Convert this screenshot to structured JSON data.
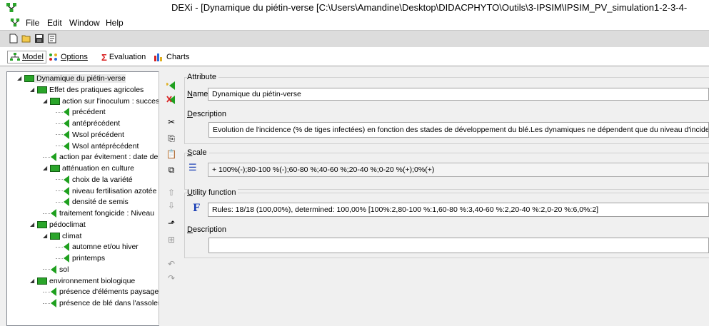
{
  "window": {
    "title": "DEXi - [Dynamique du piétin-verse [C:\\Users\\Amandine\\Desktop\\DIDACPHYTO\\Outils\\3-IPSIM\\IPSIM_PV_simulation1-2-3-4-"
  },
  "menu": [
    "File",
    "Edit",
    "Window",
    "Help"
  ],
  "toolbar": [
    "new-file-icon",
    "open-folder-icon",
    "save-icon",
    "properties-icon"
  ],
  "tabs": [
    {
      "label": "Model",
      "icon": "model-tree-icon",
      "active": true
    },
    {
      "label": "Options",
      "icon": "options-dots-icon",
      "active": false
    },
    {
      "label": "Evaluation",
      "icon": "sigma-icon",
      "active": false
    },
    {
      "label": "Charts",
      "icon": "chart-icon",
      "active": false
    }
  ],
  "tree": [
    {
      "label": "Dynamique du piétin-verse",
      "level": 0,
      "kind": "aggregate",
      "expanded": true
    },
    {
      "label": "Effet des pratiques agricoles",
      "level": 1,
      "kind": "aggregate",
      "expanded": true
    },
    {
      "label": "action sur l'inoculum : successi",
      "level": 2,
      "kind": "aggregate",
      "expanded": true
    },
    {
      "label": "précédent",
      "level": 3,
      "kind": "basic"
    },
    {
      "label": "antéprécédent",
      "level": 3,
      "kind": "basic"
    },
    {
      "label": "Wsol précédent",
      "level": 3,
      "kind": "basic"
    },
    {
      "label": "Wsol antéprécédent",
      "level": 3,
      "kind": "basic"
    },
    {
      "label": "action par évitement : date de",
      "level": 2,
      "kind": "basic"
    },
    {
      "label": "atténuation en culture",
      "level": 2,
      "kind": "aggregate",
      "expanded": true
    },
    {
      "label": "choix de la variété",
      "level": 3,
      "kind": "basic"
    },
    {
      "label": "niveau fertilisation azotée",
      "level": 3,
      "kind": "basic"
    },
    {
      "label": "densité de semis",
      "level": 3,
      "kind": "basic"
    },
    {
      "label": "traitement fongicide : Niveau",
      "level": 2,
      "kind": "basic"
    },
    {
      "label": "pédoclimat",
      "level": 1,
      "kind": "aggregate",
      "expanded": true
    },
    {
      "label": "climat",
      "level": 2,
      "kind": "aggregate",
      "expanded": true
    },
    {
      "label": "automne et/ou hiver",
      "level": 3,
      "kind": "basic"
    },
    {
      "label": "printemps",
      "level": 3,
      "kind": "basic"
    },
    {
      "label": "sol",
      "level": 2,
      "kind": "basic"
    },
    {
      "label": "environnement biologique",
      "level": 1,
      "kind": "aggregate",
      "expanded": true
    },
    {
      "label": "présence d'éléments paysager",
      "level": 2,
      "kind": "basic"
    },
    {
      "label": "présence de blé dans l'assolen",
      "level": 2,
      "kind": "basic"
    }
  ],
  "sidebar_buttons": [
    "add-attribute-icon",
    "delete-attribute-icon",
    "cut-icon",
    "copy-icon",
    "paste-icon",
    "duplicate-icon",
    "move-up-icon",
    "move-down-icon",
    "promote-icon",
    "demote-icon",
    "undo-icon",
    "redo-icon"
  ],
  "attribute": {
    "section_label": "Attribute",
    "name_label": "Name",
    "name_value": "Dynamique du piétin-verse",
    "description_label": "Description",
    "description_value": "Evolution de l'incidence (% de tiges infectées) en fonction des stades de développement du blé.Les dynamiques ne dépendent que du niveau d'incidence finale"
  },
  "scale": {
    "section_label": "Scale",
    "value": "+ 100%(-);80-100 %(-);60-80 %;40-60 %;20-40 %;0-20 %(+);0%(+)"
  },
  "utility": {
    "section_label": "Utility function",
    "value": "Rules: 18/18 (100,00%), determined: 100,00% [100%:2,80-100 %:1,60-80 %:3,40-60 %:2,20-40 %:2,0-20 %:6,0%:2]",
    "description_label": "Description",
    "description_value": ""
  },
  "colors": {
    "aggregate_green": "#2aa52a",
    "basic_green": "#1fa01f",
    "function_blue": "#1a3fb5",
    "delete_red": "#d82020"
  }
}
